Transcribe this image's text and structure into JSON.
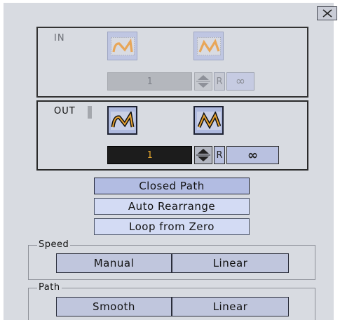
{
  "window": {
    "close_icon": "close-x-icon"
  },
  "in_section": {
    "label": "IN",
    "mode_buttons": [
      {
        "icon": "m-curve-icon",
        "selected": true
      },
      {
        "icon": "n-curve-icon",
        "selected": false
      }
    ],
    "count_value": "1",
    "stepper_icon": "up-down-arrows-icon",
    "reset_label": "R",
    "infinite_label": "∞",
    "enabled": false
  },
  "out_section": {
    "label": "OUT",
    "mode_buttons": [
      {
        "icon": "m-curve-icon",
        "selected": true
      },
      {
        "icon": "n-curve-icon",
        "selected": false
      }
    ],
    "count_value": "1",
    "stepper_icon": "up-down-arrows-icon",
    "reset_label": "R",
    "infinite_label": "∞",
    "enabled": true
  },
  "options": {
    "closed_path": "Closed Path",
    "auto_rearrange": "Auto Rearrange",
    "loop_from_zero": "Loop from Zero"
  },
  "speed_group": {
    "label": "Speed",
    "buttons": [
      "Manual",
      "Linear"
    ]
  },
  "path_group": {
    "label": "Path",
    "buttons": [
      "Smooth",
      "Linear"
    ]
  },
  "colors": {
    "accent_orange": "#e2a52e",
    "button_blue": "#b2bce2",
    "panel_gray": "#d8dbe1"
  }
}
